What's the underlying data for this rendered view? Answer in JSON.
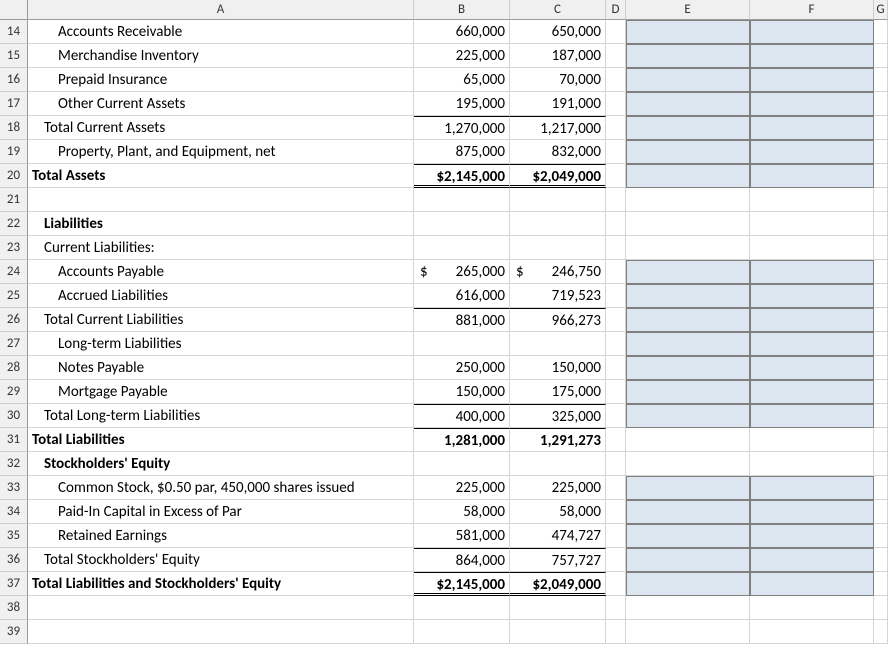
{
  "columns": [
    "",
    "A",
    "B",
    "C",
    "D",
    "E",
    "F",
    "G"
  ],
  "rows": [
    {
      "n": 14,
      "a": "Accounts Receivable",
      "ind": 2,
      "b": "660,000",
      "c": "650,000",
      "hi": true
    },
    {
      "n": 15,
      "a": "Merchandise Inventory",
      "ind": 2,
      "b": "225,000",
      "c": "187,000",
      "hi": true
    },
    {
      "n": 16,
      "a": "Prepaid Insurance",
      "ind": 2,
      "b": "65,000",
      "c": "70,000",
      "hi": true
    },
    {
      "n": 17,
      "a": "Other Current Assets",
      "ind": 2,
      "b": "195,000",
      "c": "191,000",
      "hi": true
    },
    {
      "n": 18,
      "a": "Total Current Assets",
      "ind": 1,
      "b": "1,270,000",
      "c": "1,217,000",
      "topB": true,
      "hi": true
    },
    {
      "n": 19,
      "a": "Property, Plant, and Equipment, net",
      "ind": 2,
      "b": "875,000",
      "c": "832,000",
      "hi": true
    },
    {
      "n": 20,
      "a": "Total Assets",
      "ind": 0,
      "bold": true,
      "b": "$2,145,000",
      "c": "$2,049,000",
      "topB": true,
      "dbl": true,
      "hi": true
    },
    {
      "n": 21,
      "a": "",
      "ind": 0
    },
    {
      "n": 22,
      "a": "Liabilities",
      "ind": 1,
      "bold": true
    },
    {
      "n": 23,
      "a": "Current Liabilities:",
      "ind": 1
    },
    {
      "n": 24,
      "a": "Accounts Payable",
      "ind": 2,
      "bCur": "265,000",
      "cCur": "246,750",
      "hi": true
    },
    {
      "n": 25,
      "a": "Accrued Liabilities",
      "ind": 2,
      "b": "616,000",
      "c": "719,523",
      "hi": true
    },
    {
      "n": 26,
      "a": "Total Current Liabilities",
      "ind": 1,
      "b": "881,000",
      "c": "966,273",
      "topB": true,
      "hi": true
    },
    {
      "n": 27,
      "a": "Long-term Liabilities",
      "ind": 2,
      "hi": true
    },
    {
      "n": 28,
      "a": "Notes Payable",
      "ind": 2,
      "b": "250,000",
      "c": "150,000",
      "hi": true
    },
    {
      "n": 29,
      "a": "Mortgage Payable",
      "ind": 2,
      "b": "150,000",
      "c": "175,000",
      "hi": true
    },
    {
      "n": 30,
      "a": "Total Long-term Liabilities",
      "ind": 1,
      "b": "400,000",
      "c": "325,000",
      "topB": true,
      "hi": true
    },
    {
      "n": 31,
      "a": "Total Liabilities",
      "ind": 0,
      "bold": true,
      "b": "1,281,000",
      "c": "1,291,273",
      "topB": true
    },
    {
      "n": 32,
      "a": "Stockholders' Equity",
      "ind": 1,
      "bold": true
    },
    {
      "n": 33,
      "a": "Common Stock, $0.50 par, 450,000 shares issued",
      "ind": 2,
      "b": "225,000",
      "c": "225,000",
      "hi": true
    },
    {
      "n": 34,
      "a": "Paid-In Capital in Excess of Par",
      "ind": 2,
      "b": "58,000",
      "c": "58,000",
      "hi": true
    },
    {
      "n": 35,
      "a": "Retained Earnings",
      "ind": 2,
      "b": "581,000",
      "c": "474,727",
      "hi": true
    },
    {
      "n": 36,
      "a": "Total Stockholders' Equity",
      "ind": 1,
      "b": "864,000",
      "c": "757,727",
      "topB": true,
      "hi": true
    },
    {
      "n": 37,
      "a": "Total Liabilities and Stockholders' Equity",
      "ind": 0,
      "bold": true,
      "b": "$2,145,000",
      "c": "$2,049,000",
      "topB": true,
      "dbl": true,
      "hi": true
    },
    {
      "n": 38,
      "a": "",
      "ind": 0
    },
    {
      "n": 39,
      "a": "",
      "ind": 0
    }
  ]
}
